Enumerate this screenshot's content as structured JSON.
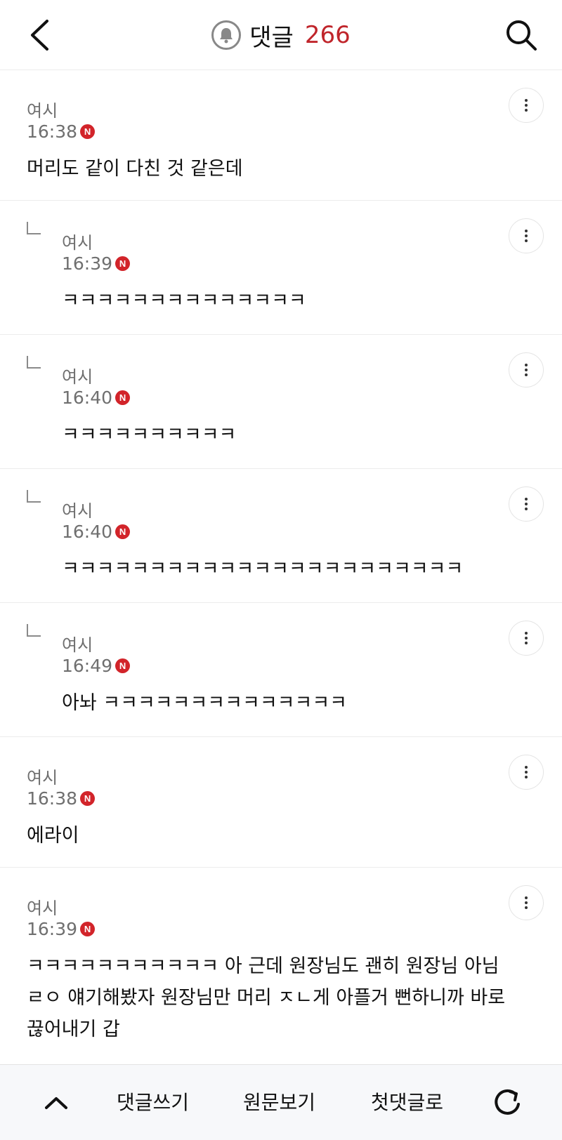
{
  "header": {
    "back_icon": "back-chevron-icon",
    "bell_icon": "bell-icon",
    "title": "댓글",
    "count": "266",
    "search_icon": "search-icon"
  },
  "colors": {
    "accent_red": "#c0252b",
    "badge_red": "#d2242a",
    "meta_gray": "#6f6f6f"
  },
  "comments": [
    {
      "type": "top",
      "author": "여시",
      "time": "16:38",
      "badge": "N",
      "text": "머리도 같이 다친 것 같은데"
    },
    {
      "type": "reply",
      "author": "여시",
      "time": "16:39",
      "badge": "N",
      "text": "ㅋㅋㅋㅋㅋㅋㅋㅋㅋㅋㅋㅋㅋㅋ"
    },
    {
      "type": "reply",
      "author": "여시",
      "time": "16:40",
      "badge": "N",
      "text": "ㅋㅋㅋㅋㅋㅋㅋㅋㅋㅋ"
    },
    {
      "type": "reply",
      "author": "여시",
      "time": "16:40",
      "badge": "N",
      "text": "ㅋㅋㅋㅋㅋㅋㅋㅋㅋㅋㅋㅋㅋㅋㅋㅋㅋㅋㅋㅋㅋㅋㅋ"
    },
    {
      "type": "reply",
      "author": "여시",
      "time": "16:49",
      "badge": "N",
      "text": "아놔 ㅋㅋㅋㅋㅋㅋㅋㅋㅋㅋㅋㅋㅋㅋ"
    },
    {
      "type": "top",
      "author": "여시",
      "time": "16:38",
      "badge": "N",
      "text": "에라이"
    },
    {
      "type": "top",
      "author": "여시",
      "time": "16:39",
      "badge": "N",
      "text": "ㅋㅋㅋㅋㅋㅋㅋㅋㅋㅋㅋ 아 근데 원장님도 괜히 원장님 아님 ㄹㅇ 얘기해봤자 원장님만 머리 ㅈㄴ게 아플거 뻔하니까 바로 끊어내기 갑"
    }
  ],
  "bottom_bar": {
    "up_icon": "chevron-up-icon",
    "write_label": "댓글쓰기",
    "origin_label": "원문보기",
    "first_label": "첫댓글로",
    "refresh_icon": "refresh-icon"
  }
}
